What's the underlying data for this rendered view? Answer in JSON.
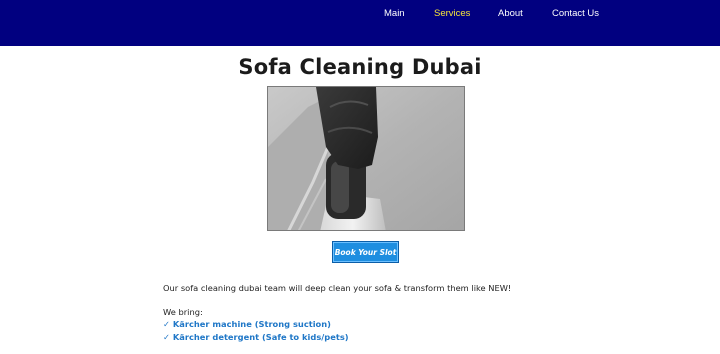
{
  "nav": {
    "items": [
      {
        "label": "Main"
      },
      {
        "label": "Services"
      },
      {
        "label": "About"
      },
      {
        "label": "Contact Us"
      }
    ],
    "active_item": "Services",
    "colors": {
      "bar": "#010080",
      "link": "#ffffff",
      "active": "#f5e33a"
    }
  },
  "main": {
    "title": "Sofa Cleaning Dubai",
    "image": {
      "depicts": "black-glove-holding-upholstery-vacuum-nozzle",
      "name": "sofa-cleaning-photo"
    },
    "cta_label": "Book Your Slot",
    "intro": "Our sofa cleaning dubai team will deep clean your sofa & transform them like NEW!",
    "we_bring_label": "We bring:",
    "features": [
      "✓ Kärcher machine (Strong suction)",
      "✓ Kärcher detergent (Safe to kids/pets)"
    ]
  },
  "colors": {
    "accent_blue": "#1e8ee0",
    "feature_text": "#1f77c7"
  }
}
